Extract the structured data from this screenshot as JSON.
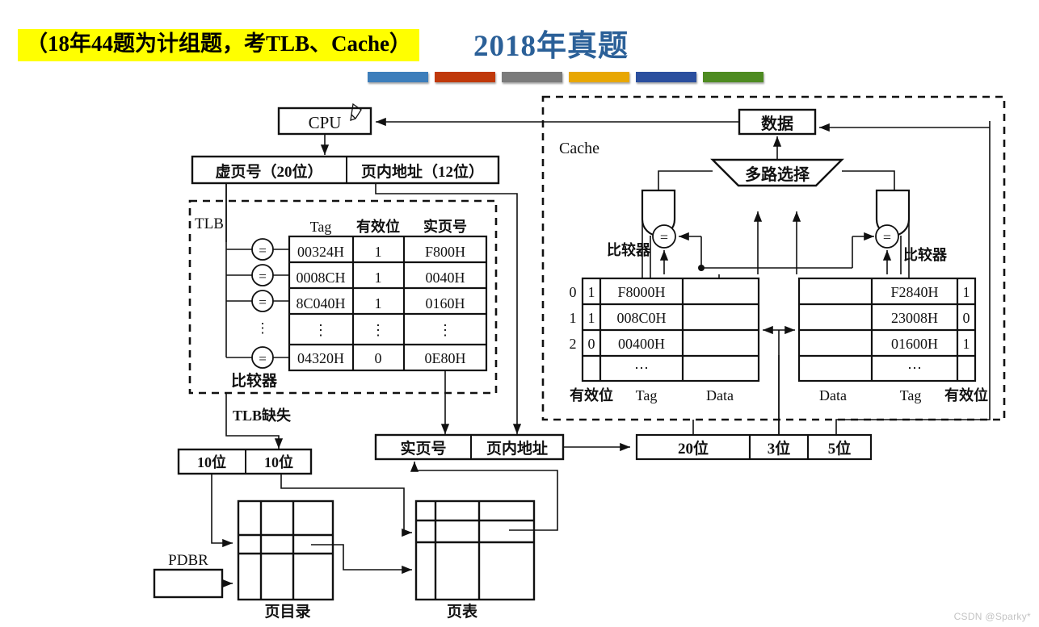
{
  "slide": {
    "highlight_banner": "（18年44题为计组题，考TLB、Cache）",
    "title": "2018年真题",
    "watermark": "CSDN @Sparky*",
    "accent_bars": [
      "#3d7ebb",
      "#c0390b",
      "#7b7b7b",
      "#e8a703",
      "#2b4f9e",
      "#4e8b21"
    ],
    "title_color": "#2b6098",
    "highlight_color": "#ffff00"
  },
  "diagram": {
    "cpu_label": "CPU",
    "virtual_address": {
      "page_number": "虚页号（20位）",
      "offset": "页内地址（12位）"
    },
    "tlb": {
      "box_label": "TLB",
      "comparator_label": "比较器",
      "headers": [
        "Tag",
        "有效位",
        "实页号"
      ],
      "rows": [
        {
          "tag": "00324H",
          "valid": "1",
          "frame": "F800H"
        },
        {
          "tag": "0008CH",
          "valid": "1",
          "frame": "0040H"
        },
        {
          "tag": "8C040H",
          "valid": "1",
          "frame": "0160H"
        },
        {
          "tag": "⋮",
          "valid": "⋮",
          "frame": "⋮"
        },
        {
          "tag": "04320H",
          "valid": "0",
          "frame": "0E80H"
        }
      ],
      "eq_symbol": "=",
      "miss_label": "TLB缺失"
    },
    "page_walk": {
      "field1": "10位",
      "field2": "10位",
      "pdbr": "PDBR",
      "page_directory": "页目录",
      "page_table": "页表"
    },
    "physical_address": {
      "frame": "实页号",
      "offset": "页内地址"
    },
    "cache_address_split": {
      "tag_bits": "20位",
      "index_bits": "3位",
      "offset_bits": "5位"
    },
    "cache": {
      "box_label": "Cache",
      "data_label": "数据",
      "mux_label": "多路选择",
      "comparator_label_left": "比较器",
      "comparator_label_right": "比较器",
      "eq_symbol": "=",
      "left_table": {
        "index_labels": [
          "0",
          "1",
          "2",
          ""
        ],
        "footers": [
          "有效位",
          "Tag",
          "Data"
        ],
        "rows": [
          {
            "index": "0",
            "valid": "1",
            "tag": "F8000H",
            "data": ""
          },
          {
            "index": "1",
            "valid": "1",
            "tag": "008C0H",
            "data": ""
          },
          {
            "index": "2",
            "valid": "0",
            "tag": "00400H",
            "data": ""
          },
          {
            "index": "",
            "valid": "",
            "tag": "⋯",
            "data": ""
          }
        ]
      },
      "right_table": {
        "footers": [
          "Data",
          "Tag",
          "有效位"
        ],
        "rows": [
          {
            "data": "",
            "tag": "F2840H",
            "valid": "1"
          },
          {
            "data": "",
            "tag": "23008H",
            "valid": "0"
          },
          {
            "data": "",
            "tag": "01600H",
            "valid": "1"
          },
          {
            "data": "",
            "tag": "⋯",
            "valid": ""
          }
        ]
      }
    }
  }
}
